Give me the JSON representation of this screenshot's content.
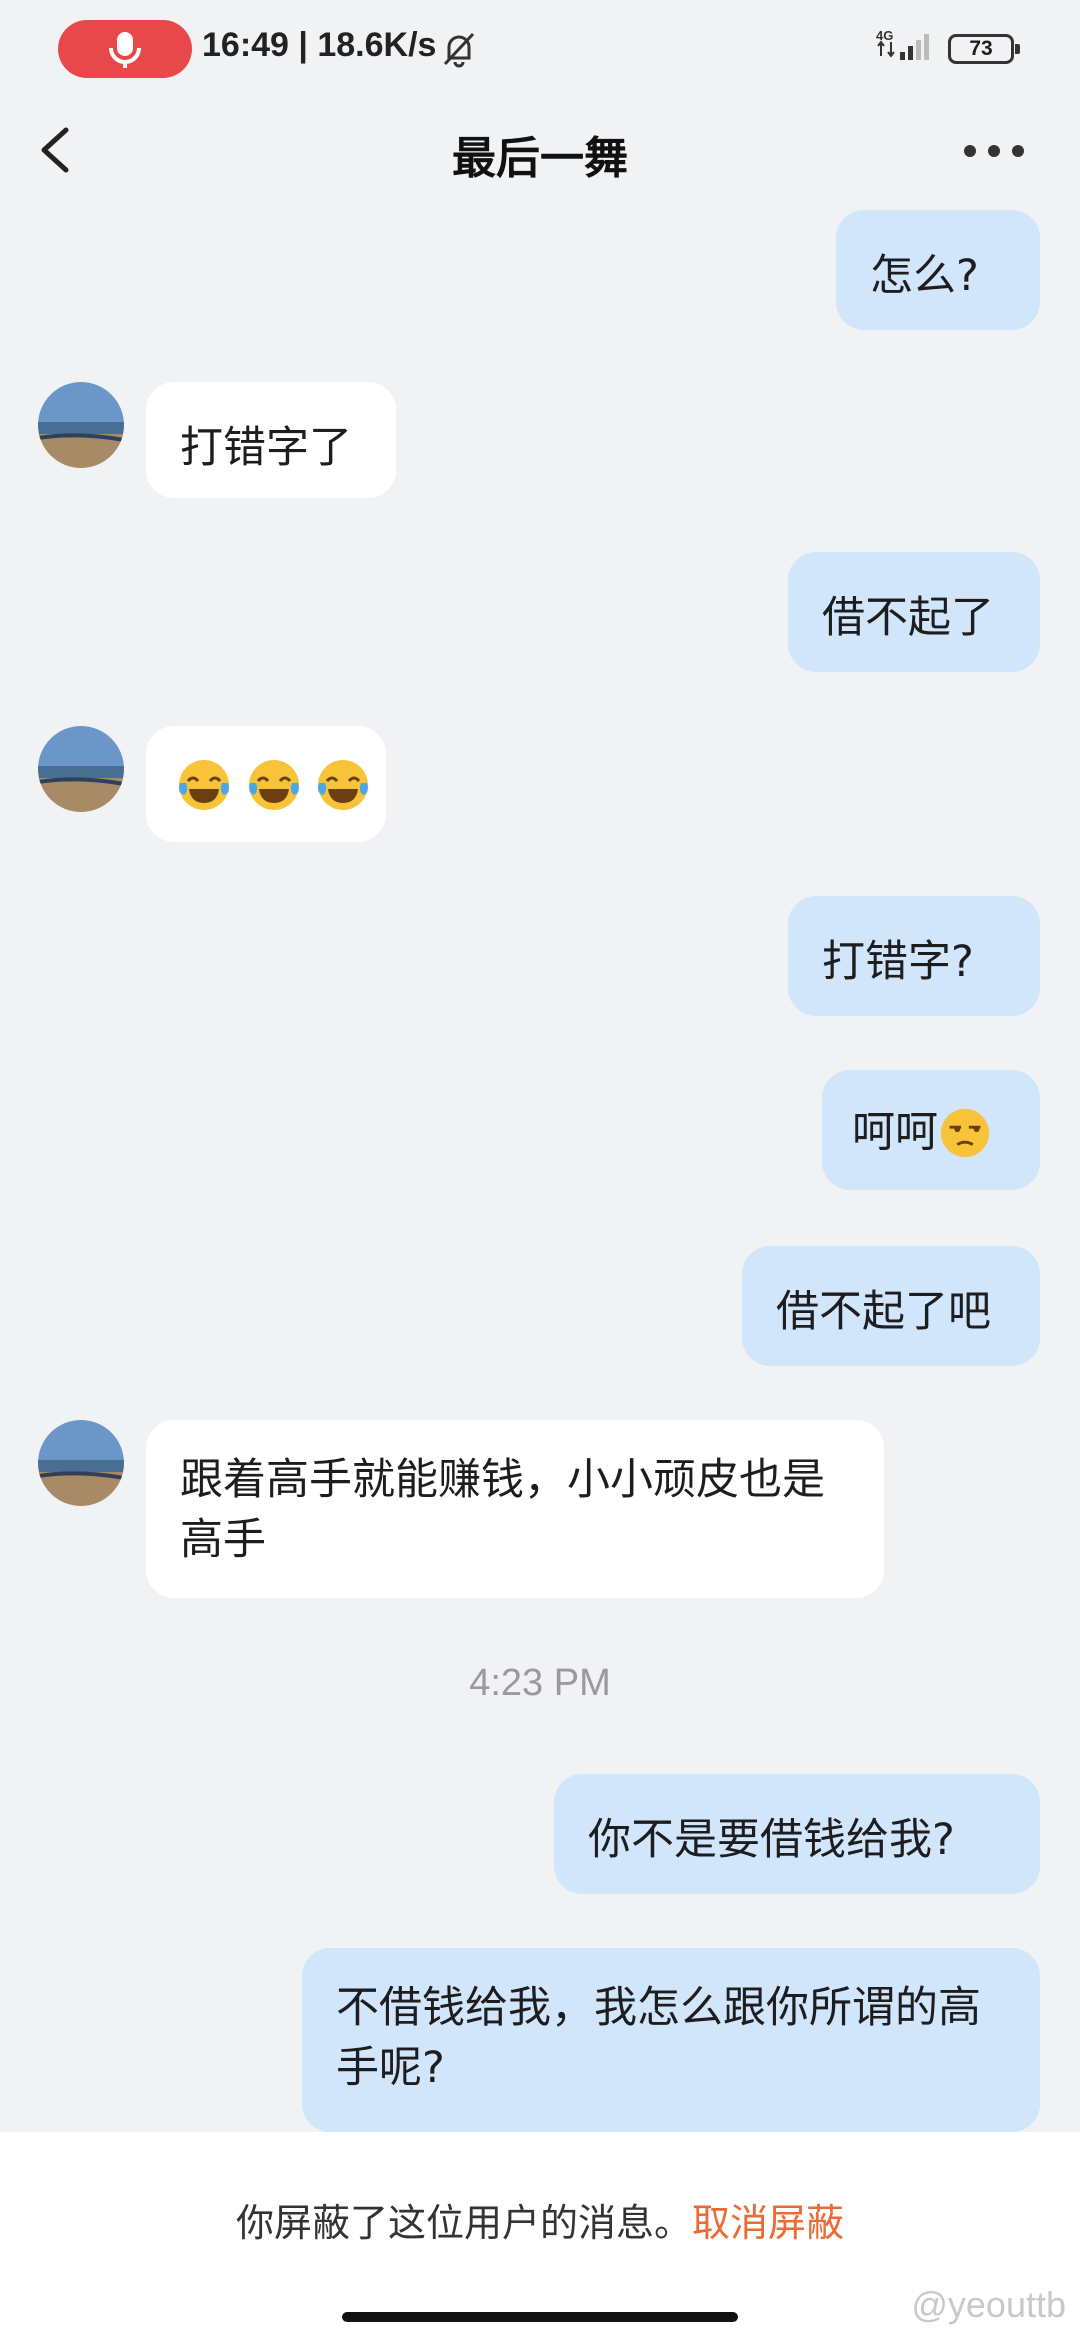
{
  "status_bar": {
    "time_text": "16:49 | 18.6K/s",
    "network_label": "4G",
    "battery_level": "73",
    "icons": [
      "mic-icon",
      "bell-off-icon",
      "signal-icon",
      "battery-icon"
    ]
  },
  "header": {
    "title": "最后一舞",
    "back_icon": "chevron-left-icon",
    "more_icon": "more-dots-icon"
  },
  "messages": [
    {
      "from": "me",
      "text": "怎么?"
    },
    {
      "from": "them",
      "text": "打错字了"
    },
    {
      "from": "me",
      "text": "借不起了"
    },
    {
      "from": "them",
      "text": "",
      "emoji": [
        "tears-of-joy",
        "tears-of-joy",
        "tears-of-joy"
      ]
    },
    {
      "from": "me",
      "text": "打错字?"
    },
    {
      "from": "me",
      "text": "呵呵",
      "emoji": [
        "unamused"
      ]
    },
    {
      "from": "me",
      "text": "借不起了吧"
    },
    {
      "from": "them",
      "text": "跟着高手就能赚钱，小小顽皮也是高手"
    },
    {
      "timestamp": "4:23 PM"
    },
    {
      "from": "me",
      "text": "你不是要借钱给我?"
    },
    {
      "from": "me",
      "text": "不借钱给我，我怎么跟你所谓的高手呢?"
    }
  ],
  "footer": {
    "blocked_text": "你屏蔽了这位用户的消息。",
    "unblock_label": "取消屏蔽",
    "watermark": "@yeouttb"
  },
  "colors": {
    "background": "#f1f2f4",
    "my_bubble": "#d2e6fb",
    "their_bubble": "#ffffff",
    "accent_link": "#ec6a35",
    "record_pill": "#e8484c"
  }
}
